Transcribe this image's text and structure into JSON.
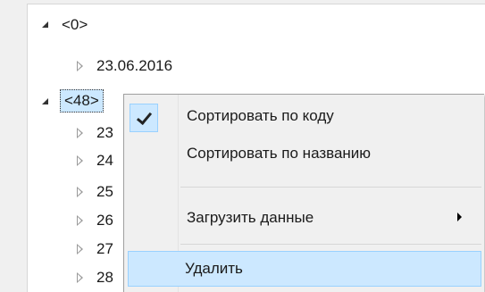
{
  "tree": {
    "nodes": [
      {
        "label": "<0>",
        "state": "expanded"
      },
      {
        "label": "23.06.2016",
        "state": "collapsed"
      },
      {
        "label": "<48>",
        "state": "expanded",
        "selected": true
      },
      {
        "label": "23",
        "state": "collapsed"
      },
      {
        "label": "24",
        "state": "collapsed"
      },
      {
        "label": "25",
        "state": "collapsed"
      },
      {
        "label": "26",
        "state": "collapsed"
      },
      {
        "label": "27",
        "state": "collapsed"
      },
      {
        "label": "28",
        "state": "collapsed"
      }
    ]
  },
  "context_menu": {
    "items": [
      {
        "label": "Сортировать по коду",
        "checked": true
      },
      {
        "label": "Сортировать по названию"
      },
      {
        "label": "Загрузить данные",
        "has_submenu": true
      },
      {
        "label": "Удалить",
        "highlighted": true
      }
    ]
  },
  "colors": {
    "selection": "#cce8ff",
    "selection_border": "#99d1ff",
    "menu_bg": "#f0f0f0"
  },
  "icons": {
    "expanded_arrow": "triangle-down-right-icon",
    "collapsed_arrow": "triangle-right-icon",
    "check": "checkmark-icon",
    "submenu": "submenu-arrow-icon"
  }
}
